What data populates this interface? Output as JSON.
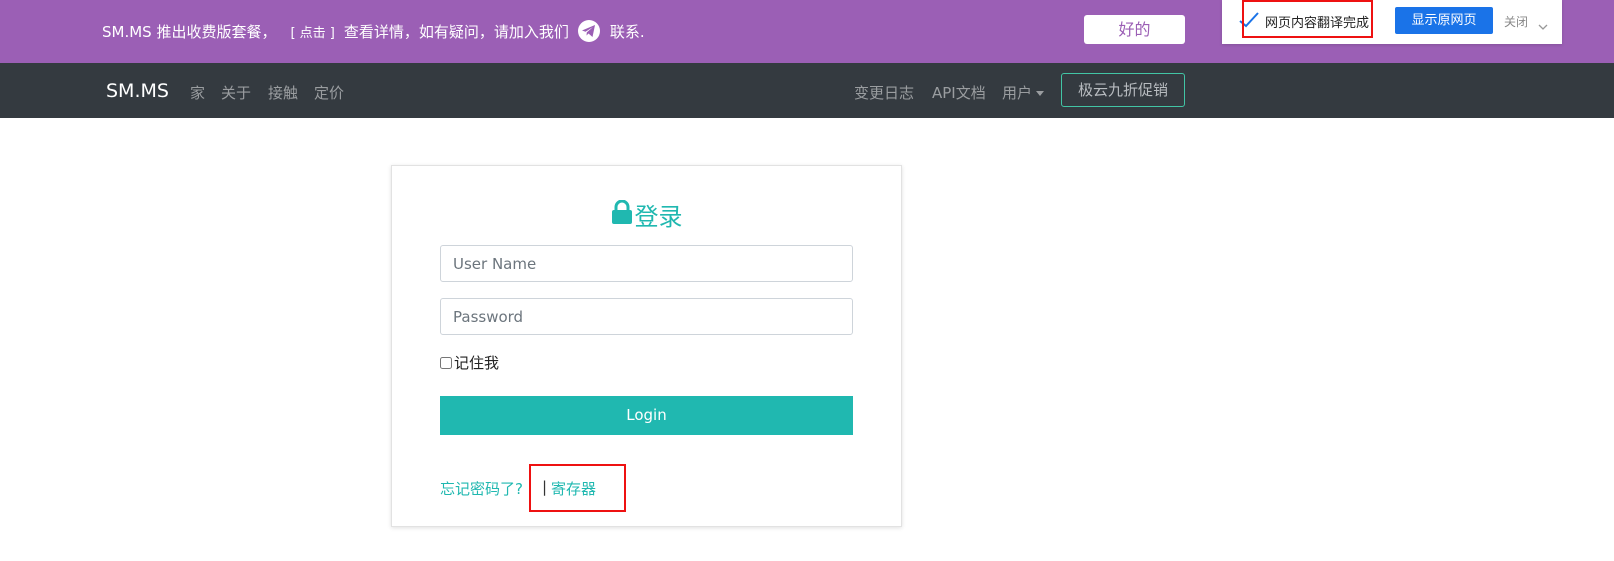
{
  "announcement": {
    "text_before": "SM.MS 推出收费版套餐，",
    "link_label": "[ 点击 ]",
    "text_after": "查看详情，如有疑问，请加入我们",
    "text_end": "联系.",
    "ok_button": "好的"
  },
  "translate_bar": {
    "status": "网页内容翻译完成",
    "show_original": "显示原网页",
    "close": "关闭"
  },
  "navbar": {
    "brand": "SM.MS",
    "left_links": [
      "家",
      "关于",
      "接触",
      "定价"
    ],
    "right_links": [
      "变更日志",
      "API文档"
    ],
    "user_menu": "用户",
    "promo_button": "极云九折促销"
  },
  "login": {
    "title": "登录",
    "username_placeholder": "User Name",
    "password_placeholder": "Password",
    "remember_label": "记住我",
    "login_button": "Login",
    "forgot_link": "忘记密码了?",
    "separator": "|",
    "register_link": "寄存器"
  },
  "colors": {
    "announcement_bg": "#9b5fb5",
    "navbar_bg": "#343a40",
    "accent": "#20b8b0"
  }
}
